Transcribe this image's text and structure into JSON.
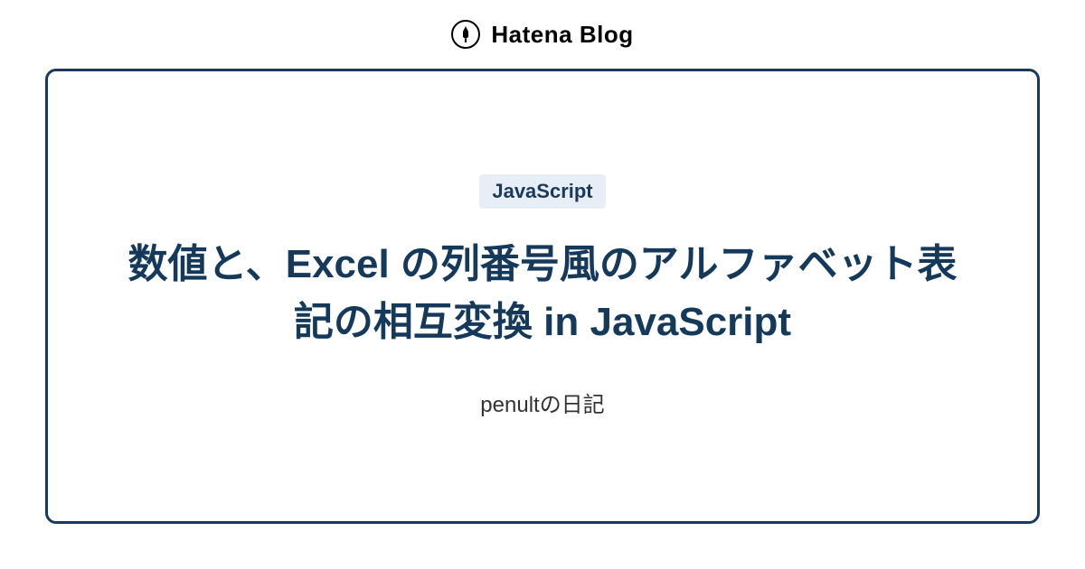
{
  "header": {
    "brand": "Hatena Blog"
  },
  "card": {
    "tag": "JavaScript",
    "title": "数値と、Excel の列番号風のアルファベット表記の相互変換 in JavaScript",
    "subtitle": "penultの日記"
  }
}
